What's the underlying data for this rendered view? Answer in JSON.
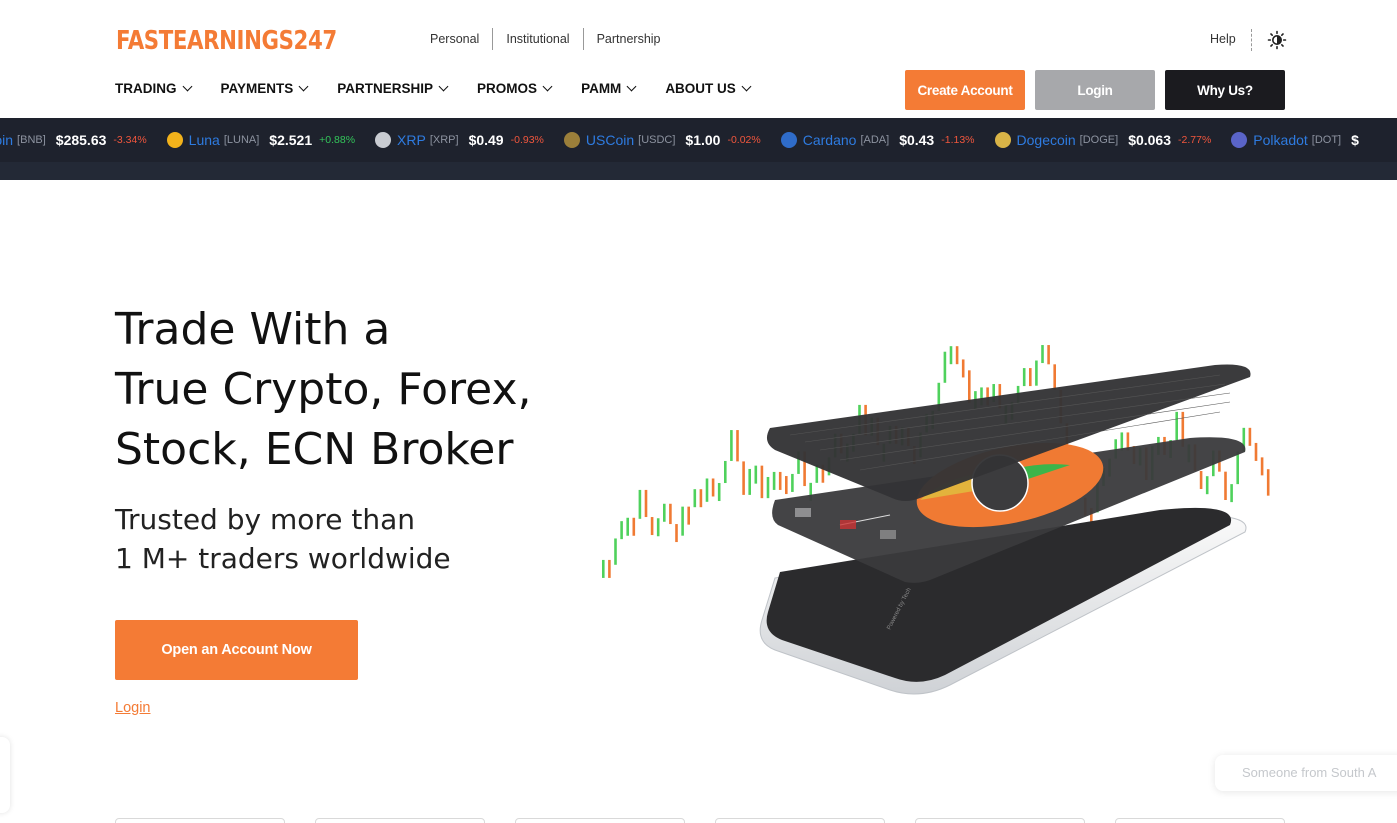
{
  "brand": {
    "logo_text": "FASTEARNINGS247",
    "accent": "#f47b35"
  },
  "segment_nav": [
    "Personal",
    "Institutional",
    "Partnership"
  ],
  "utility": {
    "help": "Help",
    "theme_icon": "sun-icon"
  },
  "main_nav": [
    "TRADING",
    "PAYMENTS",
    "PARTNERSHIP",
    "PROMOS",
    "PAMM",
    "ABOUT US"
  ],
  "header_buttons": {
    "create": "Create Account",
    "login": "Login",
    "why": "Why Us?"
  },
  "ticker": [
    {
      "name": "ance Coin",
      "symbol": "[BNB]",
      "price": "$285.63",
      "change": "-3.34%",
      "dir": "neg",
      "icon": "binance-coin-icon",
      "color": ""
    },
    {
      "name": "Luna",
      "symbol": "[LUNA]",
      "price": "$2.521",
      "change": "+0.88%",
      "dir": "pos",
      "icon": "luna-icon",
      "color": "#f2b21b"
    },
    {
      "name": "XRP",
      "symbol": "[XRP]",
      "price": "$0.49",
      "change": "-0.93%",
      "dir": "neg",
      "icon": "xrp-icon",
      "color": "#c9ccd2"
    },
    {
      "name": "USCoin",
      "symbol": "[USDC]",
      "price": "$1.00",
      "change": "-0.02%",
      "dir": "neg",
      "icon": "uscoin-icon",
      "color": "#9b7f3a"
    },
    {
      "name": "Cardano",
      "symbol": "[ADA]",
      "price": "$0.43",
      "change": "-1.13%",
      "dir": "neg",
      "icon": "cardano-icon",
      "color": "#2f6cc9"
    },
    {
      "name": "Dogecoin",
      "symbol": "[DOGE]",
      "price": "$0.063",
      "change": "-2.77%",
      "dir": "neg",
      "icon": "dogecoin-icon",
      "color": "#d9b447"
    },
    {
      "name": "Polkadot",
      "symbol": "[DOT]",
      "price": "$",
      "change": "",
      "dir": "neg",
      "icon": "polkadot-icon",
      "color": "#5a64c8"
    }
  ],
  "hero": {
    "title_lines": [
      "Trade With a",
      "True Crypto, Forex,",
      "Stock, ECN Broker"
    ],
    "subtitle_lines": [
      "Trusted by more than",
      "1 M+ traders worldwide"
    ],
    "cta": "Open an Account Now",
    "login": "Login"
  },
  "toast": {
    "text": "Someone from South A"
  }
}
